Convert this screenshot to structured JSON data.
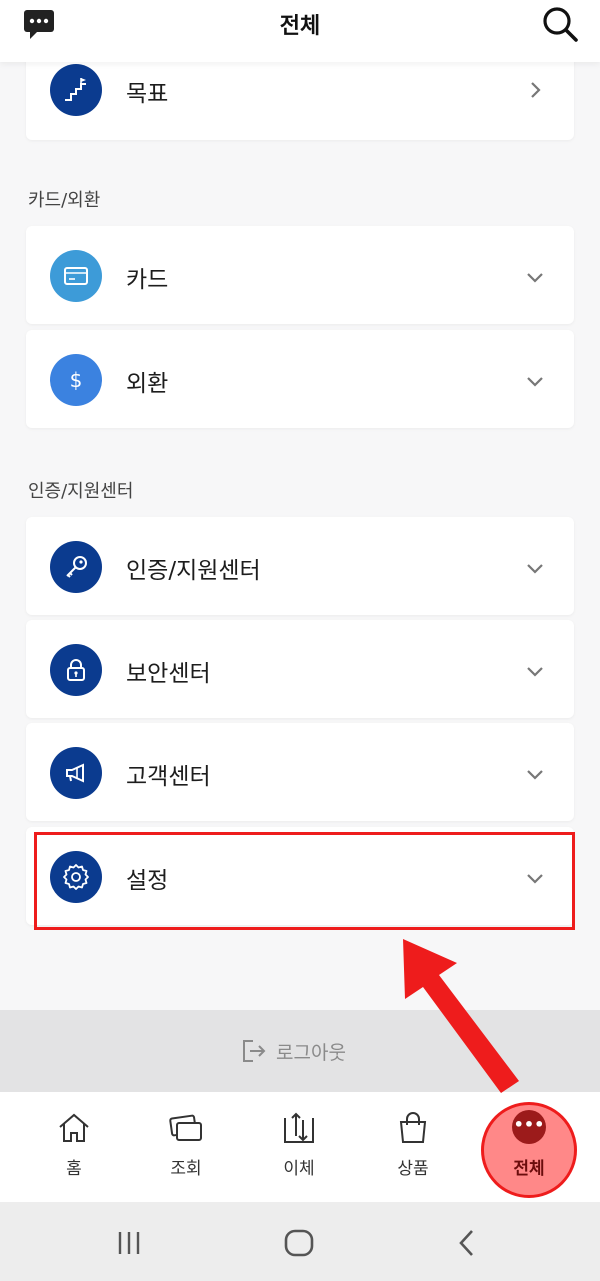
{
  "header": {
    "title": "전체",
    "chat_icon": "chat-bubble-icon",
    "search_icon": "search-icon"
  },
  "goal": {
    "label": "목표",
    "icon": "stairs-flag-icon",
    "color": "#0b3b8f"
  },
  "sections": [
    {
      "title": "카드/외환",
      "items": [
        {
          "label": "카드",
          "icon": "card-icon",
          "color": "#3d9bd8"
        },
        {
          "label": "외환",
          "icon": "dollar-icon",
          "color": "#3b82e0"
        }
      ]
    },
    {
      "title": "인증/지원센터",
      "items": [
        {
          "label": "인증/지원센터",
          "icon": "key-icon",
          "color": "#0b3b8f"
        },
        {
          "label": "보안센터",
          "icon": "lock-icon",
          "color": "#0b3b8f"
        },
        {
          "label": "고객센터",
          "icon": "megaphone-icon",
          "color": "#0b3b8f"
        },
        {
          "label": "설정",
          "icon": "gear-icon",
          "color": "#0b3b8f"
        }
      ]
    }
  ],
  "logout": {
    "label": "로그아웃",
    "icon": "logout-icon"
  },
  "bottom_nav": [
    {
      "label": "홈",
      "icon": "home-icon"
    },
    {
      "label": "조회",
      "icon": "cards-icon"
    },
    {
      "label": "이체",
      "icon": "transfer-icon"
    },
    {
      "label": "상품",
      "icon": "shopping-bag-icon"
    },
    {
      "label": "전체",
      "icon": "more-dots-icon",
      "dots": "•••"
    }
  ],
  "system_nav": [
    "recent-apps-icon",
    "home-circle-icon",
    "back-icon"
  ],
  "colors": {
    "accent_red": "#ee1c1c",
    "navy": "#0b3b8f",
    "active_dark_red": "#9c1b1b"
  }
}
